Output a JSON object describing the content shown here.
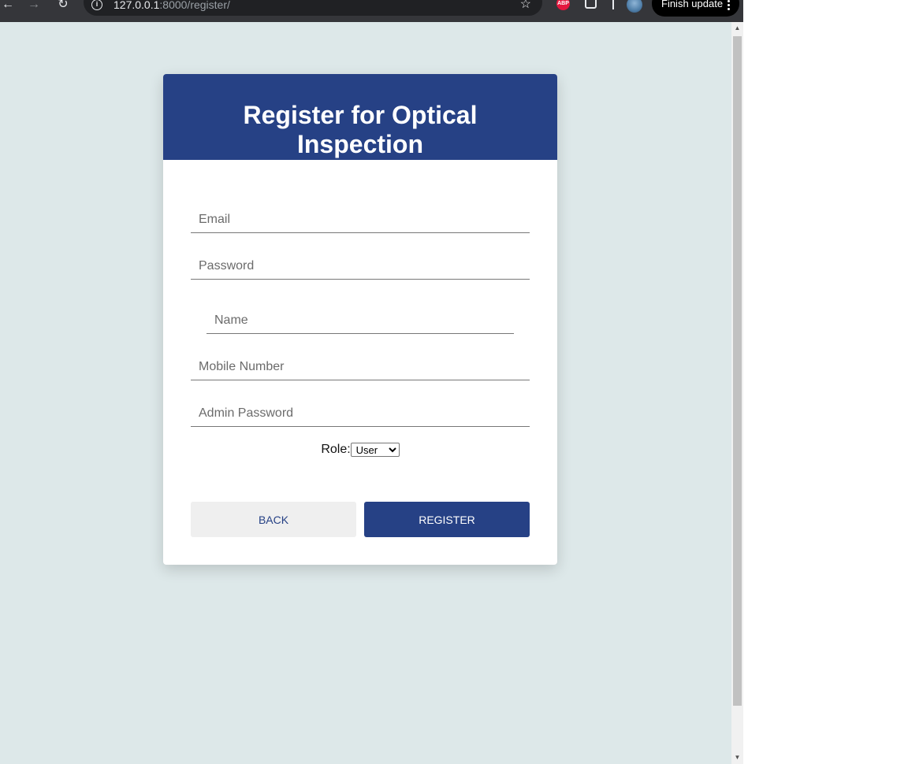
{
  "browser": {
    "url_host": "127.0.0.1",
    "url_rest": ":8000/register/",
    "update_button": "Finish update",
    "extension_abp": "ABP"
  },
  "icons": {
    "back": "arrow-left-icon",
    "forward": "arrow-right-icon",
    "reload": "reload-icon",
    "site_info": "info-icon",
    "bookmark": "star-icon",
    "extensions": "puzzle-icon",
    "menu": "kebab-menu-icon"
  },
  "form": {
    "title": "Register for Optical Inspection",
    "email_placeholder": "Email",
    "password_placeholder": "Password",
    "name_placeholder": "Name",
    "mobile_placeholder": "Mobile Number",
    "admin_password_placeholder": "Admin Password",
    "role_label": "Role:",
    "role_selected": "User",
    "back_label": "BACK",
    "register_label": "REGISTER"
  },
  "colors": {
    "brand": "#264185",
    "page_background": "#dde8e9",
    "back_button_bg": "#efefef"
  }
}
